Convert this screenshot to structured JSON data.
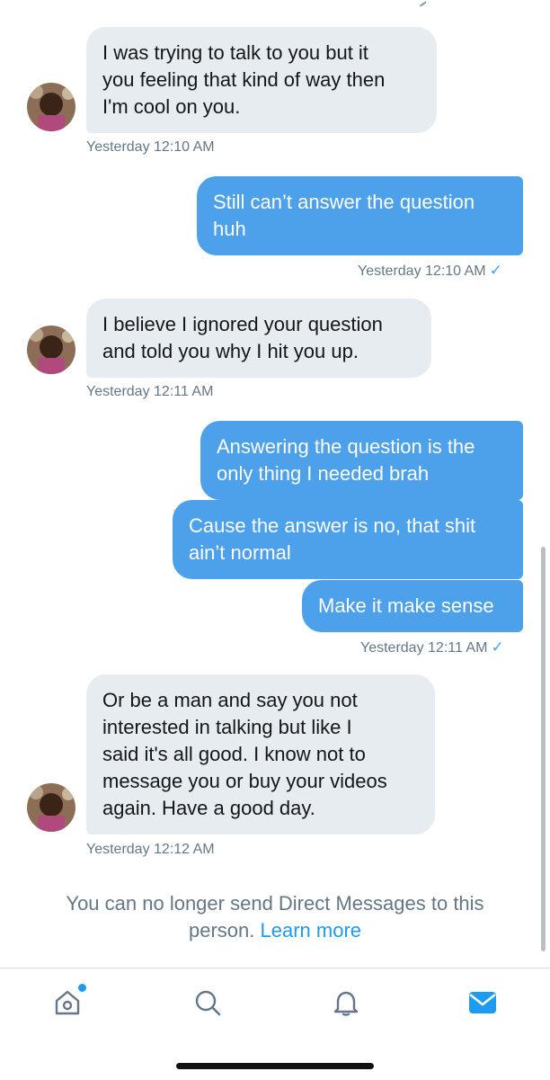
{
  "messages": [
    {
      "dir": "in",
      "text": "I was trying to talk to you but it\nyou feeling that kind of way then\nI'm cool on you.",
      "time": "Yesterday 12:10 AM"
    },
    {
      "dir": "out",
      "text": "Still can’t answer the question\nhuh",
      "time": "Yesterday 12:10 AM"
    },
    {
      "dir": "in",
      "text": "I believe I ignored your question\nand told you why I hit you up.",
      "time": "Yesterday 12:11 AM"
    },
    {
      "dir": "out",
      "text": "Answering the question is the\nonly thing I needed brah"
    },
    {
      "dir": "out",
      "text": "Cause the answer is no, that shit\nain’t normal"
    },
    {
      "dir": "out",
      "text": "Make it make sense",
      "time": "Yesterday 12:11 AM"
    },
    {
      "dir": "in",
      "text": "Or be a man and say you not\ninterested in talking but like I\nsaid it's all good.  I know not to\nmessage you or buy your videos\nagain.  Have a good day.",
      "time": "Yesterday 12:12 AM"
    }
  ],
  "notice": {
    "text": "You can no longer send Direct Messages to this person.",
    "link": "Learn more"
  },
  "read_check": "✓",
  "tabs": [
    "home-icon",
    "search-icon",
    "notifications-icon",
    "messages-icon"
  ],
  "colors": {
    "accent": "#1d9bf0",
    "outgoing_bubble": "#4da0ea",
    "incoming_bubble": "#e6ecf0",
    "muted": "#657786"
  }
}
